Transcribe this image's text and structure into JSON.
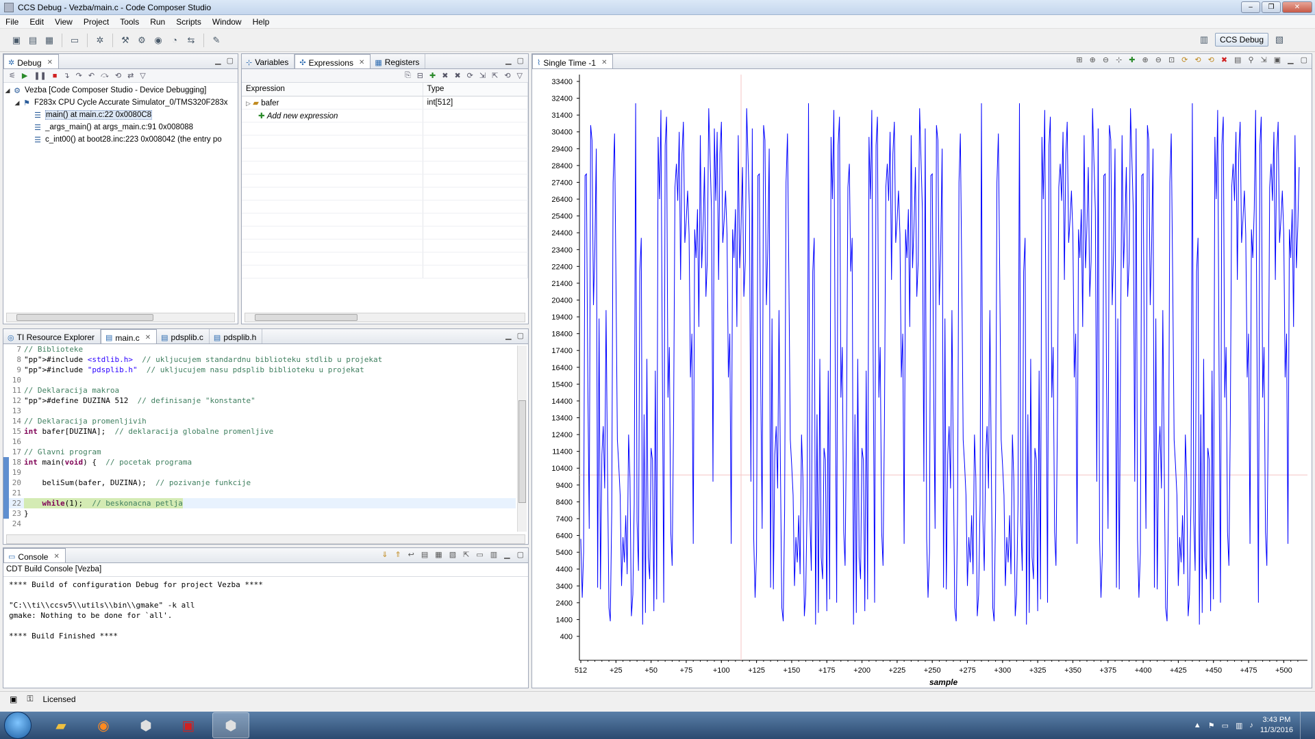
{
  "window": {
    "title": "CCS Debug - Vezba/main.c - Code Composer Studio",
    "buttons": [
      "–",
      "❐",
      "✕"
    ]
  },
  "menu": [
    "File",
    "Edit",
    "View",
    "Project",
    "Tools",
    "Run",
    "Scripts",
    "Window",
    "Help"
  ],
  "perspective": {
    "label": "CCS Debug"
  },
  "debug_view": {
    "tab": "Debug",
    "tree": [
      {
        "label": "Vezba [Code Composer Studio - Device Debugging]",
        "indent": 0
      },
      {
        "label": "F283x CPU Cycle Accurate Simulator_0/TMS320F283x",
        "indent": 1
      },
      {
        "label": "main() at main.c:22 0x0080C8",
        "indent": 2,
        "selected": true
      },
      {
        "label": "_args_main() at args_main.c:91 0x008088",
        "indent": 2
      },
      {
        "label": "c_int00() at boot28.inc:223 0x008042  (the entry po",
        "indent": 2
      }
    ]
  },
  "expressions_view": {
    "tabs": [
      "Variables",
      "Expressions",
      "Registers"
    ],
    "columns": [
      "Expression",
      "Type"
    ],
    "rows": [
      {
        "expression": "bafer",
        "type": "int[512]"
      },
      {
        "expression": "Add new expression",
        "type": ""
      }
    ]
  },
  "editor": {
    "tabs": [
      "TI Resource Explorer",
      "main.c",
      "pdsplib.c",
      "pdsplib.h"
    ],
    "lines": [
      {
        "n": "7",
        "text": "// Biblioteke"
      },
      {
        "n": "8",
        "text": "#include <stdlib.h>  // ukljucujem standardnu biblioteku stdlib u projekat"
      },
      {
        "n": "9",
        "text": "#include \"pdsplib.h\"  // ukljucujem nasu pdsplib biblioteku u projekat"
      },
      {
        "n": "10",
        "text": ""
      },
      {
        "n": "11",
        "text": "// Deklaracija makroa"
      },
      {
        "n": "12",
        "text": "#define DUZINA 512  // definisanje \"konstante\""
      },
      {
        "n": "13",
        "text": ""
      },
      {
        "n": "14",
        "text": "// Deklaracija promenljivih"
      },
      {
        "n": "15",
        "text": "int bafer[DUZINA];  // deklaracija globalne promenljive"
      },
      {
        "n": "16",
        "text": ""
      },
      {
        "n": "17",
        "text": "// Glavni program"
      },
      {
        "n": "18",
        "text": "int main(void) {  // pocetak programa"
      },
      {
        "n": "19",
        "text": ""
      },
      {
        "n": "20",
        "text": "    beliSum(bafer, DUZINA);  // pozivanje funkcije"
      },
      {
        "n": "21",
        "text": ""
      },
      {
        "n": "22",
        "text": "    while(1);  // beskonacna petlja"
      },
      {
        "n": "23",
        "text": "}"
      },
      {
        "n": "24",
        "text": ""
      }
    ]
  },
  "console": {
    "tab": "Console",
    "header": "CDT Build Console [Vezba]",
    "lines": [
      "**** Build of configuration Debug for project Vezba ****",
      "",
      "\"C:\\\\ti\\\\ccsv5\\\\utils\\\\bin\\\\gmake\" -k all",
      "gmake: Nothing to be done for `all'.",
      "",
      "**** Build Finished ****"
    ]
  },
  "graph_view": {
    "tab": "Single Time -1"
  },
  "status": {
    "license": "Licensed"
  },
  "taskbar": {
    "time": "3:43 PM",
    "date": "11/3/2016"
  },
  "chart_data": {
    "type": "line",
    "title": "",
    "xlabel": "sample",
    "ylabel": "",
    "ylim": [
      0,
      33400
    ],
    "xlim": [
      0,
      512
    ],
    "x_tick_labels": [
      "512",
      "+25",
      "+50",
      "+75",
      "+100",
      "+125",
      "+150",
      "+175",
      "+200",
      "+225",
      "+250",
      "+275",
      "+300",
      "+325",
      "+350",
      "+375",
      "+400",
      "+425",
      "+450",
      "+475",
      "+500"
    ],
    "y_tick_labels": [
      "33400",
      "32400",
      "31400",
      "30400",
      "29400",
      "28400",
      "27400",
      "26400",
      "25400",
      "24400",
      "23400",
      "22400",
      "21400",
      "20400",
      "19400",
      "18400",
      "17400",
      "16400",
      "15400",
      "14400",
      "13400",
      "12400",
      "11400",
      "10400",
      "9400",
      "8400",
      "7400",
      "6400",
      "5400",
      "4400",
      "3400",
      "2400",
      "1400",
      "400"
    ],
    "color": "#0000ff",
    "cursor_x": 114,
    "cursor_y": 10000,
    "n_samples": 512,
    "series": [
      {
        "values": [
          6200,
          30100,
          3200,
          26300,
          8800,
          25800,
          22100,
          2700,
          26400,
          11200,
          30400,
          3400,
          18800,
          24100,
          5400,
          31700,
          12900,
          21600,
          6300,
          30200,
          1100,
          27800,
          16400,
          9200,
          29100,
          4800,
          22300,
          13600,
          27900,
          2400,
          19800,
          31000,
          7600,
          24800,
          1800,
          15200,
          29600,
          10400,
          23800,
          4100,
          28300,
          16900,
          6800,
          31300,
          2100,
          25200,
          12400,
          20600,
          5100,
          30800,
          14600,
          1300,
          26900,
          9800,
          22700,
          3800,
          29900,
          17600,
          7900,
          24300,
          1600,
          31800,
          11600,
          20100,
          6600,
          27400,
          15800,
          2900,
          28700,
          10900,
          23400,
          4600,
          30300,
          18400,
          8300,
          25700,
          1900,
          29400,
          13300,
          21800,
          5900,
          32100,
          9600,
          16200,
          3300,
          27100,
          12100,
          24600,
          7300,
          30600,
          2600,
          19300,
          28500,
          10600,
          22900,
          4300
        ]
      }
    ]
  }
}
